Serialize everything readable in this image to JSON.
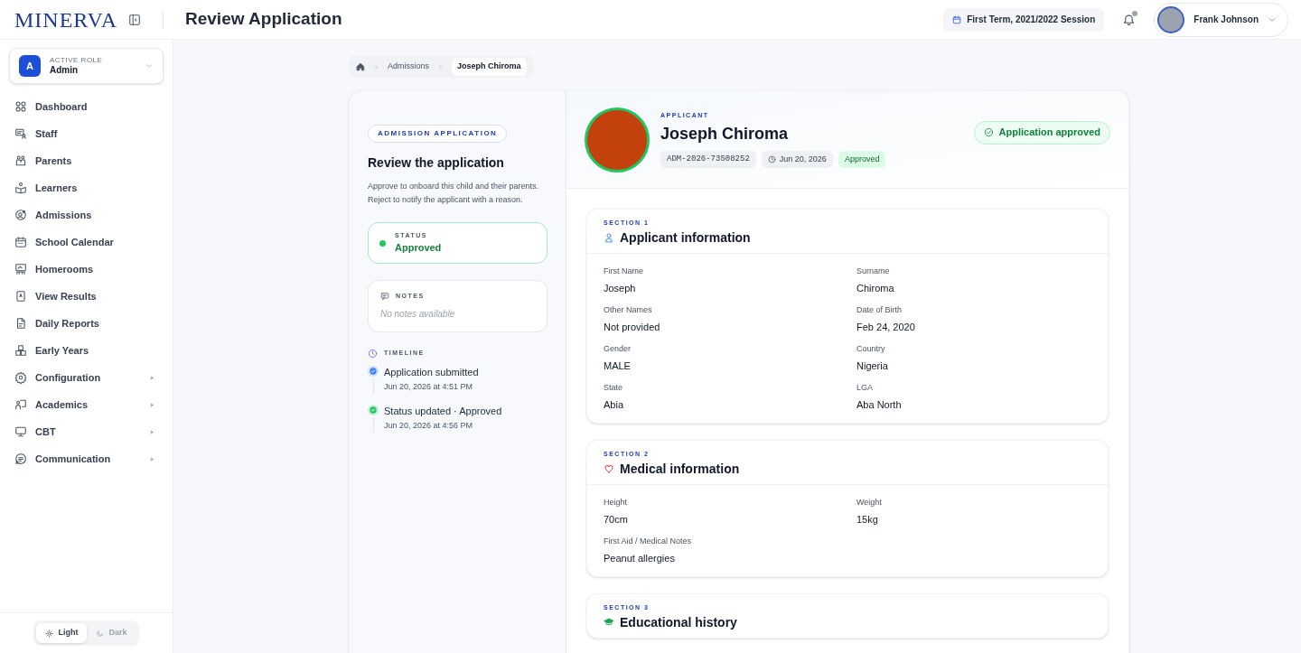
{
  "header": {
    "logo": "MINERVA",
    "title": "Review Application",
    "session": "First Term, 2021/2022 Session",
    "notification_dot": true,
    "user": "Frank Johnson"
  },
  "sidebar": {
    "role": {
      "avatar": "A",
      "label": "ACTIVE ROLE",
      "value": "Admin"
    },
    "items": [
      {
        "label": "Dashboard",
        "submenu": false
      },
      {
        "label": "Staff",
        "submenu": false
      },
      {
        "label": "Parents",
        "submenu": false
      },
      {
        "label": "Learners",
        "submenu": false
      },
      {
        "label": "Admissions",
        "submenu": false
      },
      {
        "label": "School Calendar",
        "submenu": false
      },
      {
        "label": "Homerooms",
        "submenu": false
      },
      {
        "label": "View Results",
        "submenu": false
      },
      {
        "label": "Daily Reports",
        "submenu": false
      },
      {
        "label": "Early Years",
        "submenu": false
      },
      {
        "label": "Configuration",
        "submenu": true
      },
      {
        "label": "Academics",
        "submenu": true
      },
      {
        "label": "CBT",
        "submenu": true
      },
      {
        "label": "Communication",
        "submenu": true
      }
    ],
    "theme": [
      {
        "label": "Light",
        "selected": true
      },
      {
        "label": "Dark",
        "selected": false
      }
    ]
  },
  "breadcrumb": [
    "Admissions",
    "Joseph Chiroma"
  ],
  "review": {
    "tag": "ADMISSION APPLICATION",
    "title": "Review the application",
    "description": "Approve to onboard this child and their parents. Reject to notify the applicant with a reason.",
    "status": {
      "label": "STATUS",
      "value": "Approved",
      "color": "#22c55e"
    },
    "notes": {
      "label": "NOTES",
      "value": "No notes available"
    },
    "timeline": {
      "label": "TIMELINE",
      "events": [
        {
          "title": "Application submitted",
          "time": "Jun 20, 2026 at 4:51 PM",
          "color": "#3b82f6"
        },
        {
          "title": "Status updated · Approved",
          "time": "Jun 20, 2026 at 4:56 PM",
          "color": "#22c55e"
        }
      ]
    }
  },
  "applicant": {
    "eyebrow": "APPLICANT",
    "name": "Joseph Chiroma",
    "id": "ADM-2026-73508252",
    "date": "Jun 20, 2026",
    "badge": "Approved",
    "banner": "Application approved"
  },
  "sections": [
    {
      "eyebrow": "SECTION 1",
      "title": "Applicant information",
      "kind": "person",
      "fields": [
        {
          "label": "First Name",
          "value": "Joseph"
        },
        {
          "label": "Surname",
          "value": "Chiroma"
        },
        {
          "label": "Other Names",
          "value": "Not provided"
        },
        {
          "label": "Date of Birth",
          "value": "Feb 24, 2020"
        },
        {
          "label": "Gender",
          "value": "MALE"
        },
        {
          "label": "Country",
          "value": "Nigeria"
        },
        {
          "label": "State",
          "value": "Abia"
        },
        {
          "label": "LGA",
          "value": "Aba North"
        }
      ]
    },
    {
      "eyebrow": "SECTION 2",
      "title": "Medical information",
      "kind": "heart",
      "fields": [
        {
          "label": "Height",
          "value": "70cm"
        },
        {
          "label": "Weight",
          "value": "15kg"
        },
        {
          "label": "First Aid / Medical Notes",
          "value": "Peanut allergies"
        }
      ]
    },
    {
      "eyebrow": "SECTION 3",
      "title": "Educational history",
      "kind": "cap"
    }
  ]
}
